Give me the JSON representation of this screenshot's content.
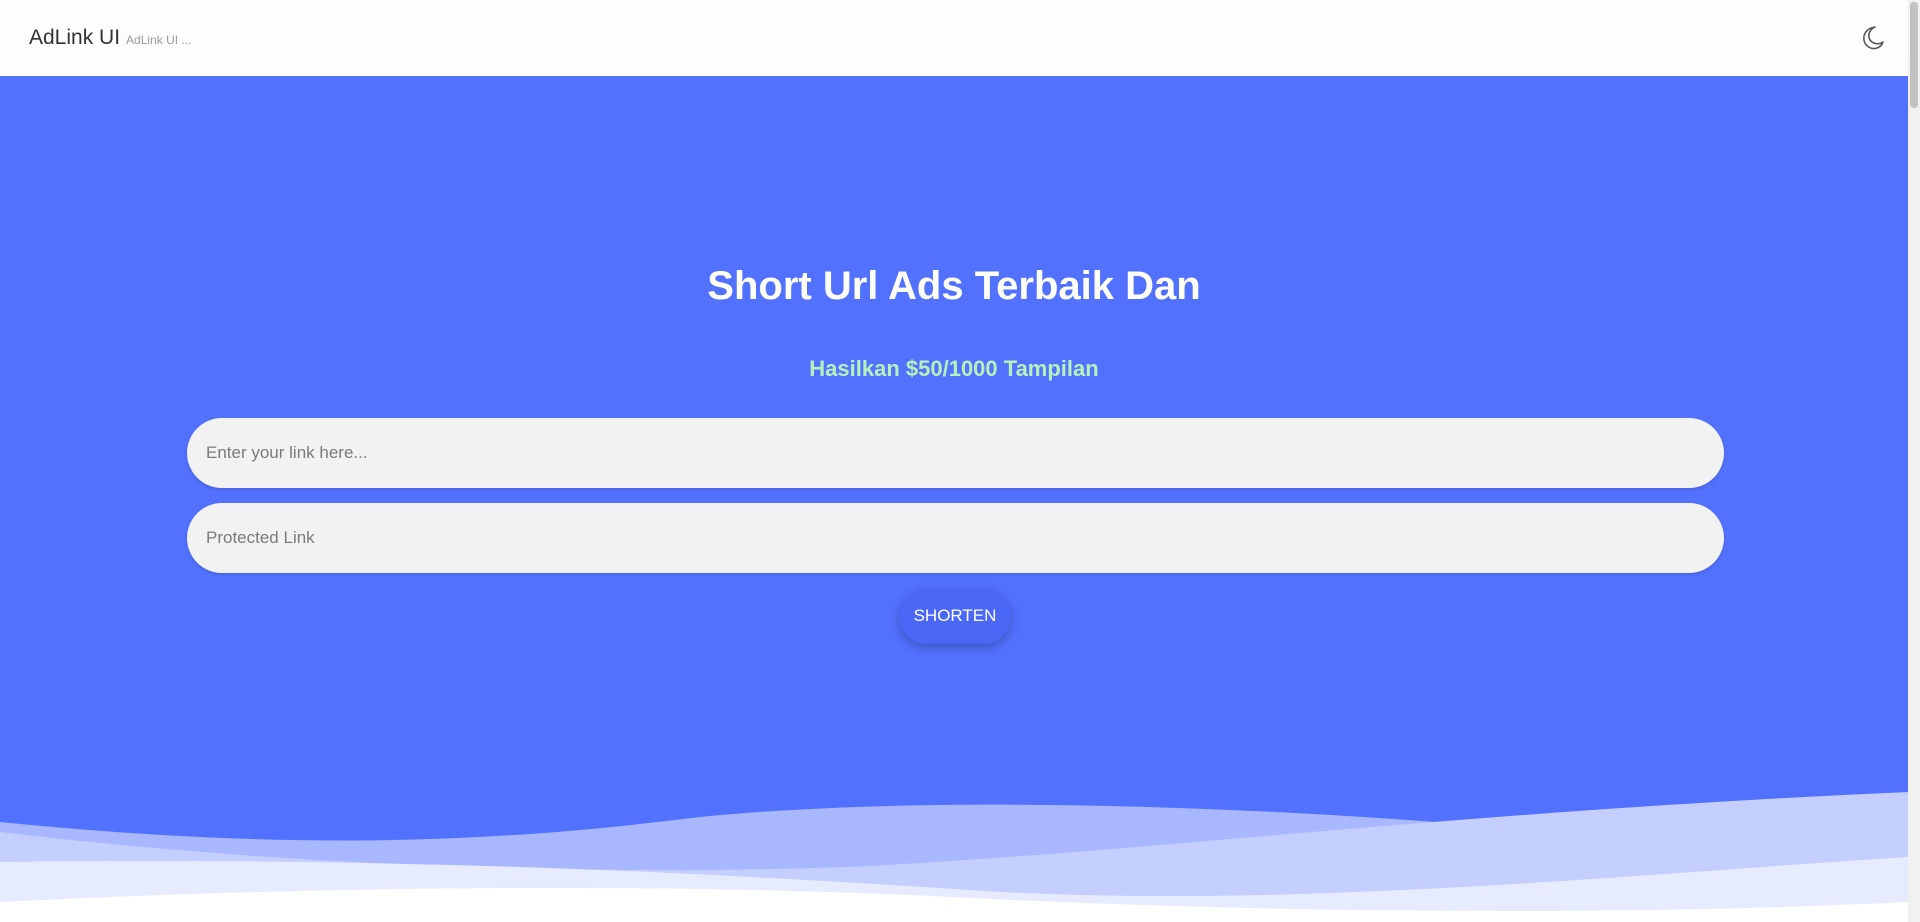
{
  "header": {
    "brand": "AdLink UI",
    "brand_sub": "AdLink UI ...",
    "theme_icon": "moon-icon"
  },
  "hero": {
    "title": "Short Url Ads Terbaik Dan",
    "subtitle": "Hasilkan $50/1000 Tampilan",
    "link_input": {
      "placeholder": "Enter your link here...",
      "value": ""
    },
    "protect_input": {
      "placeholder": "Protected Link",
      "value": ""
    },
    "shorten_label": "SHORTEN"
  },
  "colors": {
    "hero_bg": "#5271ff",
    "subtitle": "#b5f2b8",
    "button": "#4a67f5"
  }
}
